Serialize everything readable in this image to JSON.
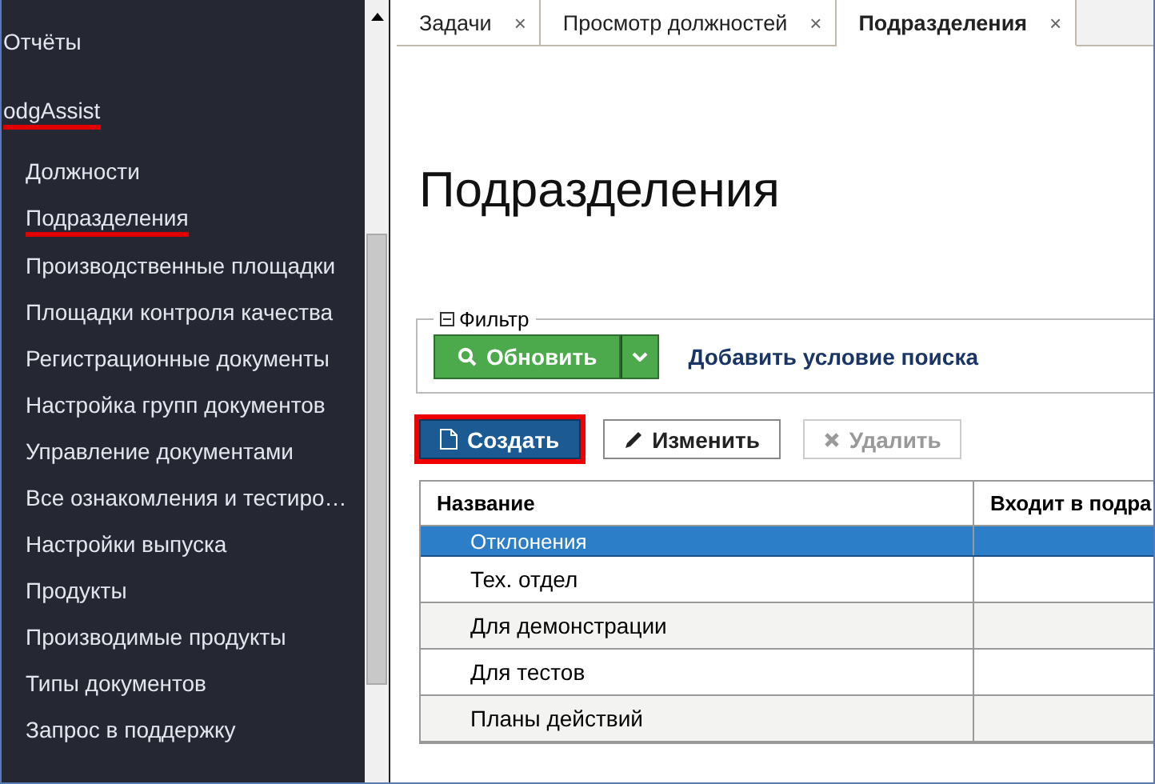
{
  "sidebar": {
    "items": [
      {
        "label": "Отчёты",
        "underlined": false
      },
      {
        "label": "odgAssist",
        "underlined": true,
        "children": [
          {
            "label": "Должности",
            "underlined": false
          },
          {
            "label": "Подразделения",
            "underlined": true
          },
          {
            "label": "Производственные площадки",
            "underlined": false
          },
          {
            "label": "Площадки контроля качества",
            "underlined": false
          },
          {
            "label": "Регистрационные документы",
            "underlined": false
          },
          {
            "label": "Настройка групп документов",
            "underlined": false
          },
          {
            "label": "Управление документами",
            "underlined": false
          },
          {
            "label": "Все ознакомления и тестиро…",
            "underlined": false
          },
          {
            "label": "Настройки выпуска",
            "underlined": false
          },
          {
            "label": "Продукты",
            "underlined": false
          },
          {
            "label": "Производимые продукты",
            "underlined": false
          },
          {
            "label": "Типы документов",
            "underlined": false
          },
          {
            "label": "Запрос в поддержку",
            "underlined": false
          }
        ]
      }
    ]
  },
  "tabs": [
    {
      "label": "Задачи",
      "close": "×",
      "selected": false
    },
    {
      "label": "Просмотр должностей",
      "close": "×",
      "selected": false
    },
    {
      "label": "Подразделения",
      "close": "×",
      "selected": true
    }
  ],
  "page_title": "Подразделения",
  "filter": {
    "legend": "Фильтр",
    "expanded": true,
    "refresh_button": "Обновить",
    "add_condition_link": "Добавить условие поиска"
  },
  "toolbar": [
    {
      "kind": "create",
      "label": "Создать",
      "disabled": false,
      "highlighted": true
    },
    {
      "kind": "edit",
      "label": "Изменить",
      "disabled": false,
      "highlighted": false
    },
    {
      "kind": "delete",
      "label": "Удалить",
      "disabled": true,
      "highlighted": false
    }
  ],
  "table": {
    "columns": [
      "Название",
      "Входит в подра"
    ],
    "rows": [
      {
        "name": "Отклонения",
        "selected": true
      },
      {
        "name": "Тех. отдел",
        "selected": false
      },
      {
        "name": "Для демонстрации",
        "selected": false
      },
      {
        "name": "Для тестов",
        "selected": false
      },
      {
        "name": "Планы действий",
        "selected": false
      }
    ]
  }
}
